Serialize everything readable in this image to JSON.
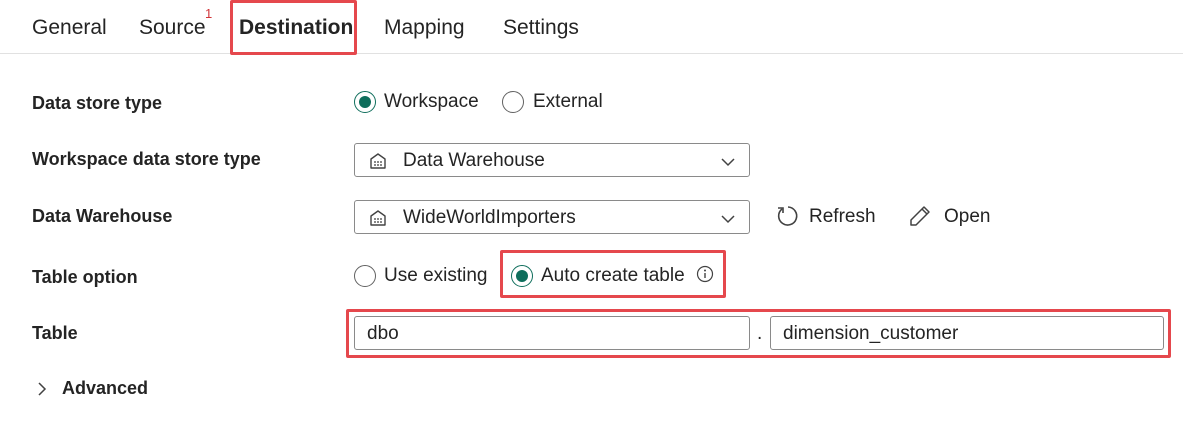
{
  "tabs": {
    "general": "General",
    "source": "Source",
    "source_badge": "1",
    "destination": "Destination",
    "mapping": "Mapping",
    "settings": "Settings"
  },
  "active_tab": "Destination",
  "form": {
    "data_store_type": {
      "label": "Data store type",
      "options": [
        "Workspace",
        "External"
      ],
      "selected": "Workspace"
    },
    "workspace_data_store_type": {
      "label": "Workspace data store type",
      "value": "Data Warehouse",
      "icon": "warehouse-icon"
    },
    "data_warehouse": {
      "label": "Data Warehouse",
      "value": "WideWorldImporters",
      "icon": "warehouse-icon",
      "refresh_label": "Refresh",
      "open_label": "Open"
    },
    "table_option": {
      "label": "Table option",
      "options": [
        "Use existing",
        "Auto create table"
      ],
      "selected": "Auto create table",
      "info_icon": "info-icon"
    },
    "table": {
      "label": "Table",
      "schema": "dbo",
      "separator": ".",
      "name": "dimension_customer"
    },
    "advanced": {
      "label": "Advanced",
      "expanded": false
    }
  },
  "colors": {
    "accent": "#0f6e5c",
    "highlight": "#e5484d",
    "badge": "#d13438",
    "border": "#8a8a8a"
  }
}
